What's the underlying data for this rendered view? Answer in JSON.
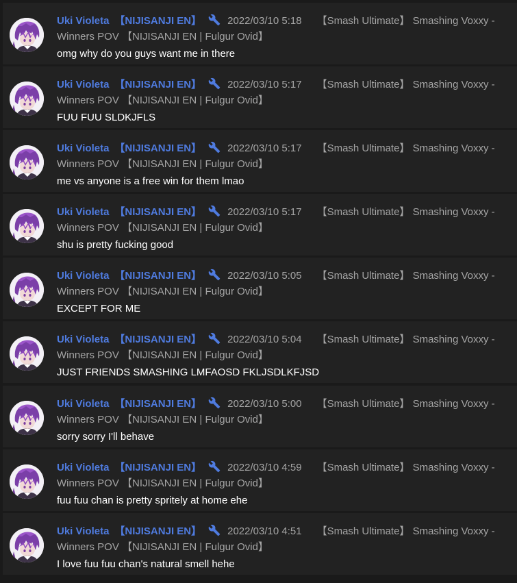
{
  "colors": {
    "background": "#1a1a1a",
    "card": "#222222",
    "author": "#4f7bdf",
    "meta": "#a6a6a6",
    "text": "#ffffff"
  },
  "comments": [
    {
      "author": "Uki Violeta",
      "tag": "【NIJISANJI EN】",
      "icon": "wrench-icon",
      "date": "2022/03/10 5:18",
      "video_title_1": "【Smash Ultimate】 Smashing Voxxy -",
      "video_title_2": "Winners POV 【NIJISANJI EN | Fulgur Ovid】",
      "text": "omg why do you guys want me in there"
    },
    {
      "author": "Uki Violeta",
      "tag": "【NIJISANJI EN】",
      "icon": "wrench-icon",
      "date": "2022/03/10 5:17",
      "video_title_1": "【Smash Ultimate】 Smashing Voxxy -",
      "video_title_2": "Winners POV 【NIJISANJI EN | Fulgur Ovid】",
      "text": "FUU FUU SLDKJFLS"
    },
    {
      "author": "Uki Violeta",
      "tag": "【NIJISANJI EN】",
      "icon": "wrench-icon",
      "date": "2022/03/10 5:17",
      "video_title_1": "【Smash Ultimate】 Smashing Voxxy -",
      "video_title_2": "Winners POV 【NIJISANJI EN | Fulgur Ovid】",
      "text": "me vs anyone is a free win for them lmao"
    },
    {
      "author": "Uki Violeta",
      "tag": "【NIJISANJI EN】",
      "icon": "wrench-icon",
      "date": "2022/03/10 5:17",
      "video_title_1": "【Smash Ultimate】 Smashing Voxxy -",
      "video_title_2": "Winners POV 【NIJISANJI EN | Fulgur Ovid】",
      "text": "shu is pretty fucking good"
    },
    {
      "author": "Uki Violeta",
      "tag": "【NIJISANJI EN】",
      "icon": "wrench-icon",
      "date": "2022/03/10 5:05",
      "video_title_1": "【Smash Ultimate】 Smashing Voxxy -",
      "video_title_2": "Winners POV 【NIJISANJI EN | Fulgur Ovid】",
      "text": "EXCEPT FOR ME"
    },
    {
      "author": "Uki Violeta",
      "tag": "【NIJISANJI EN】",
      "icon": "wrench-icon",
      "date": "2022/03/10 5:04",
      "video_title_1": "【Smash Ultimate】 Smashing Voxxy -",
      "video_title_2": "Winners POV 【NIJISANJI EN | Fulgur Ovid】",
      "text": "JUST FRIENDS SMASHING LMFAOSD FKLJSDLKFJSD"
    },
    {
      "author": "Uki Violeta",
      "tag": "【NIJISANJI EN】",
      "icon": "wrench-icon",
      "date": "2022/03/10 5:00",
      "video_title_1": "【Smash Ultimate】 Smashing Voxxy -",
      "video_title_2": "Winners POV 【NIJISANJI EN | Fulgur Ovid】",
      "text": "sorry sorry I'll behave"
    },
    {
      "author": "Uki Violeta",
      "tag": "【NIJISANJI EN】",
      "icon": "wrench-icon",
      "date": "2022/03/10 4:59",
      "video_title_1": "【Smash Ultimate】 Smashing Voxxy -",
      "video_title_2": "Winners POV 【NIJISANJI EN | Fulgur Ovid】",
      "text": "fuu fuu chan is pretty spritely at home ehe"
    },
    {
      "author": "Uki Violeta",
      "tag": "【NIJISANJI EN】",
      "icon": "wrench-icon",
      "date": "2022/03/10 4:51",
      "video_title_1": "【Smash Ultimate】 Smashing Voxxy -",
      "video_title_2": "Winners POV 【NIJISANJI EN | Fulgur Ovid】",
      "text": "I love fuu fuu chan's natural smell hehe"
    }
  ]
}
